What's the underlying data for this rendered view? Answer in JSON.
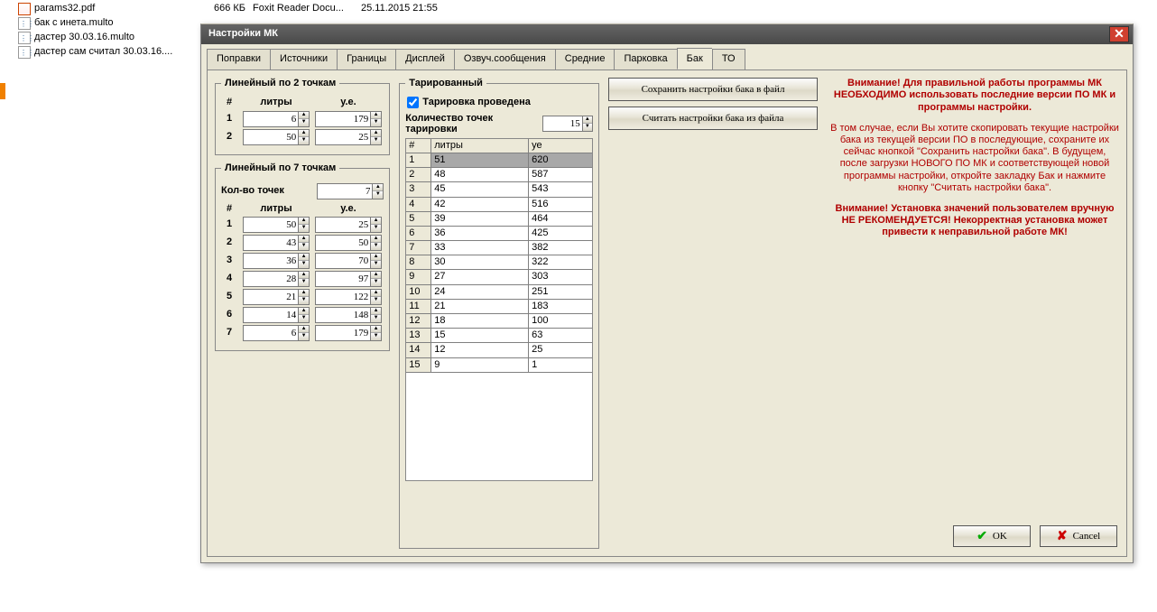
{
  "explorer": {
    "rows": [
      {
        "icon": "pdf",
        "name": "params32.pdf",
        "size": "666 КБ",
        "type": "Foxit Reader Docu...",
        "date": "25.11.2015 21:55"
      },
      {
        "icon": "multo",
        "name": "бак с инета.multo",
        "size": "",
        "type": "",
        "date": ""
      },
      {
        "icon": "multo",
        "name": "дастер 30.03.16.multo",
        "size": "",
        "type": "",
        "date": ""
      },
      {
        "icon": "multo",
        "name": "дастер сам считал 30.03.16....",
        "size": "",
        "type": "",
        "date": ""
      }
    ]
  },
  "dialog": {
    "title": "Настройки МК",
    "tabs": [
      "Поправки",
      "Источники",
      "Границы",
      "Дисплей",
      "Озвуч.сообщения",
      "Средние",
      "Парковка",
      "Бак",
      "ТО"
    ],
    "active_tab": 7,
    "lin2": {
      "title": "Линейный по 2 точкам",
      "hdr": {
        "n": "#",
        "l": "литры",
        "u": "у.е."
      },
      "rows": [
        {
          "n": "1",
          "l": "6",
          "u": "179"
        },
        {
          "n": "2",
          "l": "50",
          "u": "25"
        }
      ]
    },
    "lin7": {
      "title": "Линейный по 7 точкам",
      "count_label": "Кол-во точек",
      "count": "7",
      "hdr": {
        "n": "#",
        "l": "литры",
        "u": "у.е."
      },
      "rows": [
        {
          "n": "1",
          "l": "50",
          "u": "25"
        },
        {
          "n": "2",
          "l": "43",
          "u": "50"
        },
        {
          "n": "3",
          "l": "36",
          "u": "70"
        },
        {
          "n": "4",
          "l": "28",
          "u": "97"
        },
        {
          "n": "5",
          "l": "21",
          "u": "122"
        },
        {
          "n": "6",
          "l": "14",
          "u": "148"
        },
        {
          "n": "7",
          "l": "6",
          "u": "179"
        }
      ]
    },
    "tarir": {
      "title": "Тарированный",
      "done_label": "Тарировка проведена",
      "done": true,
      "count_label": "Количество точек тарировки",
      "count": "15",
      "cols": {
        "n": "#",
        "l": "литры",
        "u": "уе"
      },
      "rows": [
        {
          "n": "1",
          "l": "51",
          "u": "620"
        },
        {
          "n": "2",
          "l": "48",
          "u": "587"
        },
        {
          "n": "3",
          "l": "45",
          "u": "543"
        },
        {
          "n": "4",
          "l": "42",
          "u": "516"
        },
        {
          "n": "5",
          "l": "39",
          "u": "464"
        },
        {
          "n": "6",
          "l": "36",
          "u": "425"
        },
        {
          "n": "7",
          "l": "33",
          "u": "382"
        },
        {
          "n": "8",
          "l": "30",
          "u": "322"
        },
        {
          "n": "9",
          "l": "27",
          "u": "303"
        },
        {
          "n": "10",
          "l": "24",
          "u": "251"
        },
        {
          "n": "11",
          "l": "21",
          "u": "183"
        },
        {
          "n": "12",
          "l": "18",
          "u": "100"
        },
        {
          "n": "13",
          "l": "15",
          "u": "63"
        },
        {
          "n": "14",
          "l": "12",
          "u": "25"
        },
        {
          "n": "15",
          "l": "9",
          "u": "1"
        }
      ]
    },
    "btn_save": "Сохранить настройки бака в файл",
    "btn_load": "Считать настройки бака из файла",
    "warn1": "Внимание! Для правильной работы программы МК НЕОБХОДИМО использовать последние версии ПО МК и программы настройки.",
    "warn2": "В том случае, если Вы хотите скопировать текущие настройки бака из текущей версии ПО в последующие, сохраните их сейчас кнопкой \"Сохранить настройки бака\". В будущем, после загрузки НОВОГО ПО МК и соответствующей новой программы настройки, откройте закладку Бак и нажмите кнопку \"Считать настройки бака\".",
    "warn3": "Внимание! Установка значений пользователем вручную НЕ РЕКОМЕНДУЕТСЯ! Некорректная установка может привести к неправильной работе МК!",
    "ok": "OK",
    "cancel": "Cancel"
  }
}
